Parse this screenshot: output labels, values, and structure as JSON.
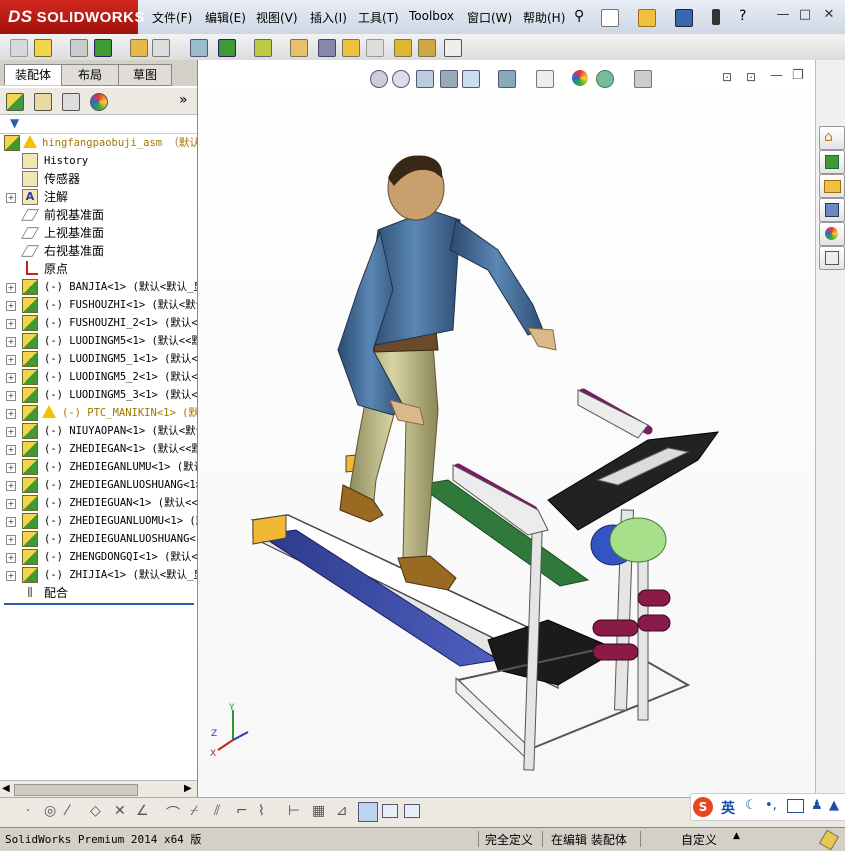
{
  "app": {
    "brand": "SOLIDWORKS",
    "brand_prefix": "DS"
  },
  "menu": {
    "items": [
      "文件(F)",
      "编辑(E)",
      "视图(V)",
      "插入(I)",
      "工具(T)",
      "Toolbox",
      "窗口(W)",
      "帮助(H)"
    ]
  },
  "panel": {
    "tabs": [
      "装配体",
      "布局",
      "草图"
    ],
    "collapse_label": "»"
  },
  "tree": {
    "root": "hingfangpaobuji_asm （默认",
    "items": [
      {
        "label": "History",
        "icon": "history-icon",
        "expand": false
      },
      {
        "label": "传感器",
        "icon": "sensor-icon",
        "expand": false
      },
      {
        "label": "注解",
        "icon": "annotation-icon",
        "expand": true
      },
      {
        "label": "前视基准面",
        "icon": "plane-icon",
        "expand": false
      },
      {
        "label": "上视基准面",
        "icon": "plane-icon",
        "expand": false
      },
      {
        "label": "右视基准面",
        "icon": "plane-icon",
        "expand": false
      },
      {
        "label": "原点",
        "icon": "origin-icon",
        "expand": false
      },
      {
        "label": "(-) BANJIA<1> (默认<默认_显",
        "icon": "part-icon",
        "expand": true
      },
      {
        "label": "(-) FUSHOUZHI<1> (默认<默认",
        "icon": "part-icon",
        "expand": true
      },
      {
        "label": "(-) FUSHOUZHI_2<1> (默认<默",
        "icon": "part-icon",
        "expand": true
      },
      {
        "label": "(-) LUODINGM5<1> (默认<<默认",
        "icon": "part-icon",
        "expand": true
      },
      {
        "label": "(-) LUODINGM5_1<1> (默认<<",
        "icon": "part-icon",
        "expand": true
      },
      {
        "label": "(-) LUODINGM5_2<1> (默认<<",
        "icon": "part-icon",
        "expand": true
      },
      {
        "label": "(-) LUODINGM5_3<1> (默认<<",
        "icon": "part-icon",
        "expand": true
      },
      {
        "label": "(-) PTC_MANIKIN<1> (默认",
        "icon": "part-icon",
        "expand": true,
        "warn": true
      },
      {
        "label": "(-) NIUYAOPAN<1> (默认<默认",
        "icon": "part-icon",
        "expand": true
      },
      {
        "label": "(-) ZHEDIEGAN<1> (默认<<默认",
        "icon": "part-icon",
        "expand": true
      },
      {
        "label": "(-) ZHEDIEGANLUMU<1> (默认<",
        "icon": "part-icon",
        "expand": true
      },
      {
        "label": "(-) ZHEDIEGANLUOSHUANG<1> (",
        "icon": "part-icon",
        "expand": true
      },
      {
        "label": "(-) ZHEDIEGUAN<1> (默认<<默",
        "icon": "part-icon",
        "expand": true
      },
      {
        "label": "(-) ZHEDIEGUANLUOMU<1> (默",
        "icon": "part-icon",
        "expand": true
      },
      {
        "label": "(-) ZHEDIEGUANLUOSHUANG<1>",
        "icon": "part-icon",
        "expand": true
      },
      {
        "label": "(-) ZHENGDONGQI<1> (默认<<",
        "icon": "part-icon",
        "expand": true
      },
      {
        "label": "(-) ZHIJIA<1> (默认<默认_显",
        "icon": "part-icon",
        "expand": true
      },
      {
        "label": "配合",
        "icon": "mates-icon",
        "expand": false
      }
    ]
  },
  "triad": {
    "x": "X",
    "y": "Y",
    "z": "Z"
  },
  "ime": {
    "lang": "英"
  },
  "status": {
    "product": "SolidWorks Premium 2014 x64 版",
    "defined": "完全定义",
    "editing": "在编辑 装配体",
    "units": "自定义"
  },
  "colors": {
    "brand": "#c0241b",
    "warning": "#f2c200"
  }
}
